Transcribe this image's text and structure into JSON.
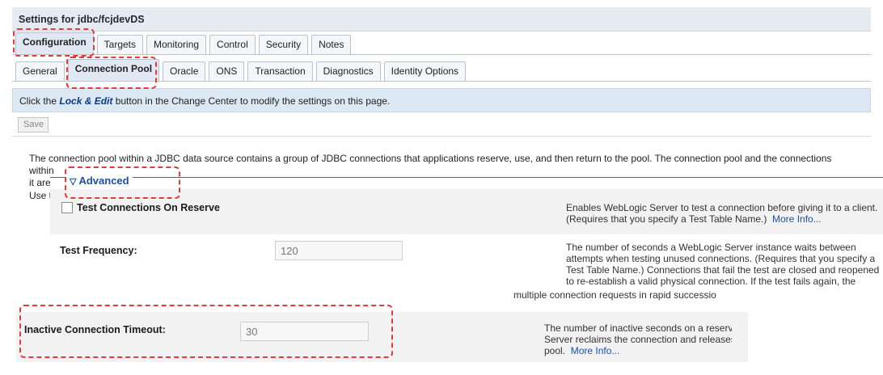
{
  "header": {
    "title": "Settings for jdbc/fcjdevDS"
  },
  "main_tabs": [
    {
      "label": "Configuration",
      "active": true
    },
    {
      "label": "Targets",
      "active": false
    },
    {
      "label": "Monitoring",
      "active": false
    },
    {
      "label": "Control",
      "active": false
    },
    {
      "label": "Security",
      "active": false
    },
    {
      "label": "Notes",
      "active": false
    }
  ],
  "sub_tabs": [
    {
      "label": "General",
      "active": false
    },
    {
      "label": "Connection Pool",
      "active": true
    },
    {
      "label": "Oracle",
      "active": false
    },
    {
      "label": "ONS",
      "active": false
    },
    {
      "label": "Transaction",
      "active": false
    },
    {
      "label": "Diagnostics",
      "active": false
    },
    {
      "label": "Identity Options",
      "active": false
    }
  ],
  "info_bar": {
    "prefix": "Click the ",
    "lock_text": "Lock & Edit",
    "suffix": " button in the Change Center to modify the settings on this page."
  },
  "save_button": {
    "label": "Save"
  },
  "description": {
    "line1": "The connection pool within a JDBC data source contains a group of JDBC connections that applications reserve, use, and then return to the pool. The connection pool and the connections within",
    "line2": "it are",
    "use_text": "Use t"
  },
  "advanced": {
    "legend": "Advanced",
    "test_connections": {
      "label": "Test Connections On Reserve",
      "help": "Enables WebLogic Server to test a connection before giving it to a client. (Requires that you specify a Test Table Name.)",
      "more": "More Info..."
    },
    "test_frequency": {
      "label": "Test Frequency:",
      "value": "120",
      "help": "The number of seconds a WebLogic Server instance waits between attempts when testing unused connections. (Requires that you specify a Test Table Name.) Connections that fail the test are closed and reopened to re-establish a valid physical connection. If the test fails again, the",
      "help_tail": "multiple connection requests in rapid successio"
    },
    "inactive_timeout": {
      "label": "Inactive Connection Timeout:",
      "value": "30",
      "help_line1": "The number of inactive seconds on a reserved",
      "help_line2": "Server reclaims the connection and releases it l",
      "help_line3": "pool.",
      "more": "More Info..."
    }
  },
  "colors": {
    "accent": "#1c4ea8",
    "callout": "#e23b3b",
    "info_bar": "#dde8f5"
  }
}
